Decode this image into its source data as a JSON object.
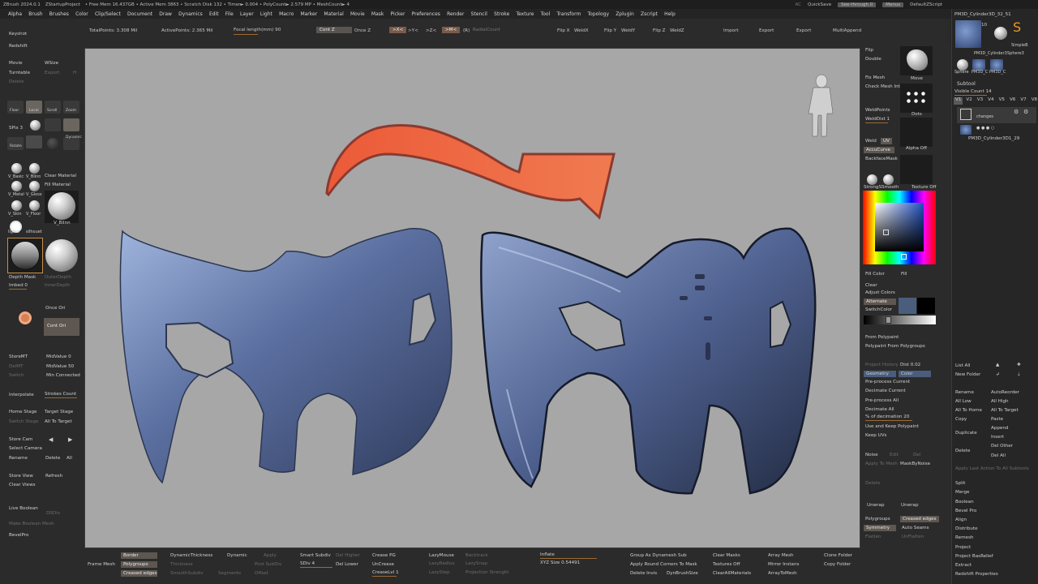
{
  "titlebar": {
    "app": "ZBrush 2024.0.1",
    "project": "ZStartupProject",
    "stats": "• Free Mem 16.437GB • Active Mem 3863 • Scratch Disk 132 • Timer► 0.004 • PolyCount► 2.579 MP • MeshCount► 4",
    "ac": "AC",
    "quicksave": "QuickSave",
    "seethrough": "See-through  0",
    "menus": "Menus",
    "script": "DefaultZScript"
  },
  "menubar": [
    "Alpha",
    "Brush",
    "Brushes",
    "Color",
    "Clip/Select",
    "Document",
    "Draw",
    "Dynamics",
    "Edit",
    "File",
    "Layer",
    "Light",
    "Macro",
    "Marker",
    "Material",
    "Movie",
    "Mask",
    "Picker",
    "Preferences",
    "Render",
    "Stencil",
    "Stroke",
    "Texture",
    "Tool",
    "Transform",
    "Topology",
    "Zplugin",
    "Zscript",
    "Help"
  ],
  "topshelf": {
    "total_points": "TotalPoints: 3.308 Mil",
    "active_points": "ActivePoints: 2.365 Mil",
    "focal": "Focal length(mm) 90",
    "cont_z": "Cont Z",
    "once_z": "Once Z",
    "x_btn": ">X<",
    "y_btn": ">Y<",
    "z_btn": ">Z<",
    "m_btn": ">M<",
    "r_btn": "(R)",
    "radial": "RadialCount",
    "flipx": "Flip X",
    "weldx": "WeldX",
    "flipy": "Flip Y",
    "weldy": "WeldY",
    "flipz": "Flip Z",
    "weldz": "WeldZ",
    "import": "Import",
    "export1": "Export",
    "export2": "Export",
    "multiappend": "MultiAppend"
  },
  "leftshelf": {
    "keyshot": "Keyshot",
    "redshift": "Redshift",
    "movie": "Movie",
    "wsize": "WSize",
    "turntable": "Turntable",
    "export": "Export",
    "h": "H",
    "delete": "Delete",
    "tools": [
      "Floor",
      "Local",
      "Scroll",
      "Zoom"
    ],
    "spix": "SPix 3",
    "rotate": "Rotate",
    "dynamic": "Dynamic",
    "mats": [
      "V_Basic",
      "V_Blinn",
      "V_Metal",
      "V_Gloss",
      "V_Skin",
      "V_Floor"
    ],
    "clear_material": "Clear Material",
    "fill_material": "Fill Material",
    "v_blinn_big": "V_Blinn",
    "lights": "lights",
    "silhouet": "silhouet",
    "depth_mask": "Depth Mask",
    "outer_depth": "OuterDepth",
    "imbed": "Imbed 0",
    "inner_depth": "InnerDepth",
    "once_ori": "Once Ori",
    "cont_ori": "Cont Ori",
    "storemt": "StoreMT",
    "midvalue0": "MidValue 0",
    "delmt": "DelMT",
    "midvalue50": "MidValue 50",
    "switch": "Switch",
    "min_connected": "Min Connected",
    "interpolate": "Interpolate",
    "strokes_count": "Strokes Count",
    "home_stage": "Home Stage",
    "target_stage": "Target Stage",
    "switch_stage": "Switch Stage",
    "all_to_target": "All To Target",
    "store_cam": "Store Cam",
    "select_camera": "Select Camera",
    "rename": "Rename",
    "delete2": "Delete",
    "all": "All",
    "store_view": "Store View",
    "refresh": "Refresh",
    "clear_views": "Clear Views",
    "live_boolean": "Live Boolean",
    "dsdiv": "DSDiv",
    "make_boolean": "Make Boolean Mesh",
    "bevelpro": "BevelPro"
  },
  "rightshelf": {
    "flip": "Flip",
    "double": "Double",
    "move": "Move",
    "fix_mesh": "Fix Mesh",
    "check_mesh": "Check Mesh Int",
    "dots": "Dots",
    "weldpoints": "WeldPoints",
    "welddist": "WeldDist 1",
    "weld": "Weld",
    "uv": "UV",
    "accucurve": "AccuCurve",
    "alpha_off": "Alpha Off",
    "backfacemask": "BackfaceMask",
    "strongsmooth": "StrongSSmooth",
    "texture_off": "Texture Off",
    "fill_color": "Fill Color",
    "fill": "Fill",
    "clear": "Clear",
    "adjust_colors": "Adjust Colors",
    "alternate": "Alternate",
    "switchcolor": "SwitchColor",
    "from_polypaint": "From Polypaint",
    "polypaint_from_polygroups": "Polypaint From Polygroups",
    "project_history": "Project History",
    "dist": "Dist 0.02",
    "geometry": "Geometry",
    "color": "Color",
    "preprocess_current": "Pre-process Current",
    "decimate_current": "Decimate Current",
    "preprocess_all": "Pre-process All",
    "decimate_all": "Decimate All",
    "pct_decimation": "% of decimation 20",
    "use_keep_polypaint": "Use and Keep Polypaint",
    "keep_uvs": "Keep UVs",
    "noise": "Noise",
    "edit": "Edit",
    "del": "Del",
    "apply_to_mesh": "Apply To Mesh",
    "maskbynoise": "MaskByNoise",
    "delete": "Delete",
    "unwrap1": "Unwrap",
    "unwrap2": "Unwrap",
    "polygroups": "Polygroups",
    "creased_edges": "Creased edges",
    "symmetry": "Symmetry",
    "auto_seams": "Auto Seams",
    "flatten": "Flatten",
    "unflatten": "UnFlatten",
    "accent_color": "#4a5d7d",
    "highlight_color": "#d0a060"
  },
  "bottomshelf": {
    "frame_mesh": "Frame Mesh",
    "border": "Border",
    "polygroups": "Polygroups",
    "creased_edges": "Creased edges",
    "dynamic_thickness": "DynamicThickness",
    "thickness": "Thickness",
    "smooth_subdiv": "SmoothSubdiv",
    "dynamic": "Dynamic",
    "apply": "Apply",
    "post_subdiv": "Post SubDiv",
    "segments": "Segments",
    "offset": "Offset",
    "smart_subdiv": "Smart Subdiv",
    "sdiv": "SDiv 4",
    "del_higher": "Del Higher",
    "del_lower": "Del Lower",
    "crease_pg": "Crease PG",
    "uncrease": "UnCrease",
    "creaselvl": "CreaseLvl 1",
    "lazymouse": "LazyMouse",
    "lazyradius": "LazyRadius",
    "lazystep": "LazyStep",
    "backtrack": "Backtrack",
    "lazysnap": "LazySnap",
    "projection_strength": "Projection Strength",
    "inflate": "Inflate",
    "xyz_size": "XYZ Size 0.54491",
    "group_as_dynamesh": "Group As Dynamesh Sub",
    "apply_round_corners": "Apply Round Corners To Mask",
    "delete_invis": "Delete Invis",
    "dynbrushsize": "DynBrushSize",
    "clear_masks": "Clear Masks",
    "textures_off": "Textures Off",
    "clear_all_materials": "ClearAllMaterials",
    "array_mesh": "Array Mesh",
    "mirror_instans": "Mirror Instans",
    "arraytomesh": "ArrayToMesh",
    "clone_folder": "Clone Folder",
    "copy_folder": "Copy Folder"
  },
  "tray": {
    "tool_name": "PM3D_Cylinder3D_32_51",
    "tool_count": "10",
    "thumbs": [
      "PM3D_Cylinder3",
      "SimpleB",
      "Sphere3",
      "Sphere",
      "PM3D_C",
      "PM3D_C"
    ],
    "cylinder_label": "PM3D_Cylinder3",
    "subtool": "Subtool",
    "visible_count": "Visible Count 14",
    "v_tabs": [
      "V1",
      "V2",
      "V3",
      "V4",
      "V5",
      "V6",
      "V7",
      "V8"
    ],
    "changes": "changes",
    "subtool_item": "PM3D_Cylinder3D1_29",
    "list_all": "List All",
    "new_folder": "New Folder",
    "rename": "Rename",
    "autoreorder": "AutoReorder",
    "all_low": "All Low",
    "all_high": "All High",
    "all_to_home": "All To Home",
    "all_to_target": "All To Target",
    "copy": "Copy",
    "paste": "Paste",
    "duplicate": "Duplicate",
    "append": "Append",
    "insert": "Insert",
    "delete": "Delete",
    "del_other": "Del Other",
    "del_all": "Del All",
    "apply_last_action": "Apply Last Action To All Subtools",
    "actions": [
      "Split",
      "Merge",
      "Boolean",
      "Bevel Pro",
      "Align",
      "Distribute",
      "Remesh",
      "Project",
      "Project BasRelief",
      "Extract",
      "Redshift Properties"
    ]
  }
}
